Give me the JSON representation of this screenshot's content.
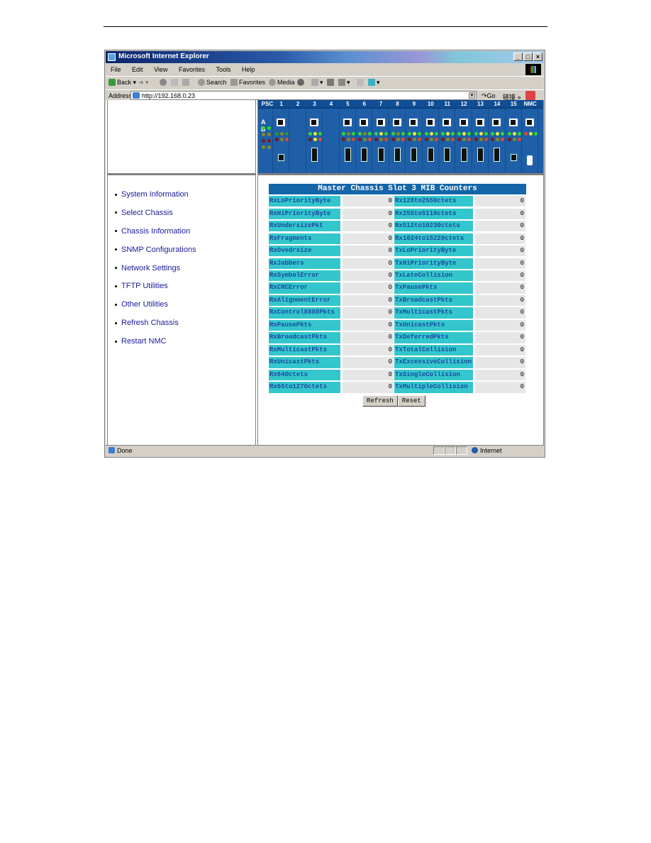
{
  "browser": {
    "title": "Microsoft Internet Explorer",
    "menu": [
      "File",
      "Edit",
      "View",
      "Favorites",
      "Tools",
      "Help"
    ],
    "toolbar": {
      "back": "Back",
      "search": "Search",
      "favorites": "Favorites",
      "media": "Media"
    },
    "address_label": "Address",
    "address_value": "http://192.168.0.23",
    "go_label": "Go",
    "links_label": "链接 »",
    "status_text": "Done",
    "zone_text": "Internet"
  },
  "chassis": {
    "psc_label": "PSC",
    "ab_label": "A B",
    "slot_labels": [
      "1",
      "2",
      "3",
      "4",
      "5",
      "6",
      "7",
      "8",
      "9",
      "10",
      "11",
      "12",
      "13",
      "14",
      "15",
      "NMC"
    ]
  },
  "nav": {
    "items": [
      "System Information",
      "Select Chassis",
      "Chassis Information",
      "SNMP Configurations",
      "Network Settings",
      "TFTP Utilities",
      "Other Utilities",
      "Refresh Chassis",
      "Restart NMC"
    ]
  },
  "mib": {
    "title": "Master Chassis Slot 3 MIB Counters",
    "rows": [
      {
        "left_name": "RxLoPriorityByte",
        "left_value": "0",
        "right_name": "Rx128to2550ctets",
        "right_value": "0"
      },
      {
        "left_name": "RxHiPriorityByte",
        "left_value": "0",
        "right_name": "Rx255to5110ctets",
        "right_value": "0"
      },
      {
        "left_name": "RxUndersizePkt",
        "left_value": "0",
        "right_name": "Rx512to10230ctets",
        "right_value": "0"
      },
      {
        "left_name": "RxFragments",
        "left_value": "0",
        "right_name": "Rx1024to15220ctets",
        "right_value": "0"
      },
      {
        "left_name": "RxOvedrsize",
        "left_value": "0",
        "right_name": "TxLoPriorityByte",
        "right_value": "0"
      },
      {
        "left_name": "RxJabbers",
        "left_value": "0",
        "right_name": "TxHiPriorityByte",
        "right_value": "0"
      },
      {
        "left_name": "RxSymbolError",
        "left_value": "0",
        "right_name": "TxLateCollision",
        "right_value": "0"
      },
      {
        "left_name": "RxCRCError",
        "left_value": "0",
        "right_name": "TxPausePkts",
        "right_value": "0"
      },
      {
        "left_name": "RxAlignmentError",
        "left_value": "0",
        "right_name": "TxBroadcastPkts",
        "right_value": "0"
      },
      {
        "left_name": "RxControl8808Pkts",
        "left_value": "0",
        "right_name": "TxMulticastPkts",
        "right_value": "0"
      },
      {
        "left_name": "RxPausePkts",
        "left_value": "0",
        "right_name": "TxUnicastPkts",
        "right_value": "0"
      },
      {
        "left_name": "RxBroadcastPkts",
        "left_value": "0",
        "right_name": "TxDeferredPkts",
        "right_value": "0"
      },
      {
        "left_name": "RxMulticastPkts",
        "left_value": "0",
        "right_name": "TxTotalCollision",
        "right_value": "0"
      },
      {
        "left_name": "RxUnicastPkts",
        "left_value": "0",
        "right_name": "TxExcessiveCollision",
        "right_value": "0"
      },
      {
        "left_name": "Rx64Octets",
        "left_value": "0",
        "right_name": "TxSingleCollision",
        "right_value": "0"
      },
      {
        "left_name": "Rx65to127Octets",
        "left_value": "0",
        "right_name": "TxMultipleCollision",
        "right_value": "0"
      }
    ],
    "refresh_label": "Refresh",
    "reset_label": "Reset"
  }
}
